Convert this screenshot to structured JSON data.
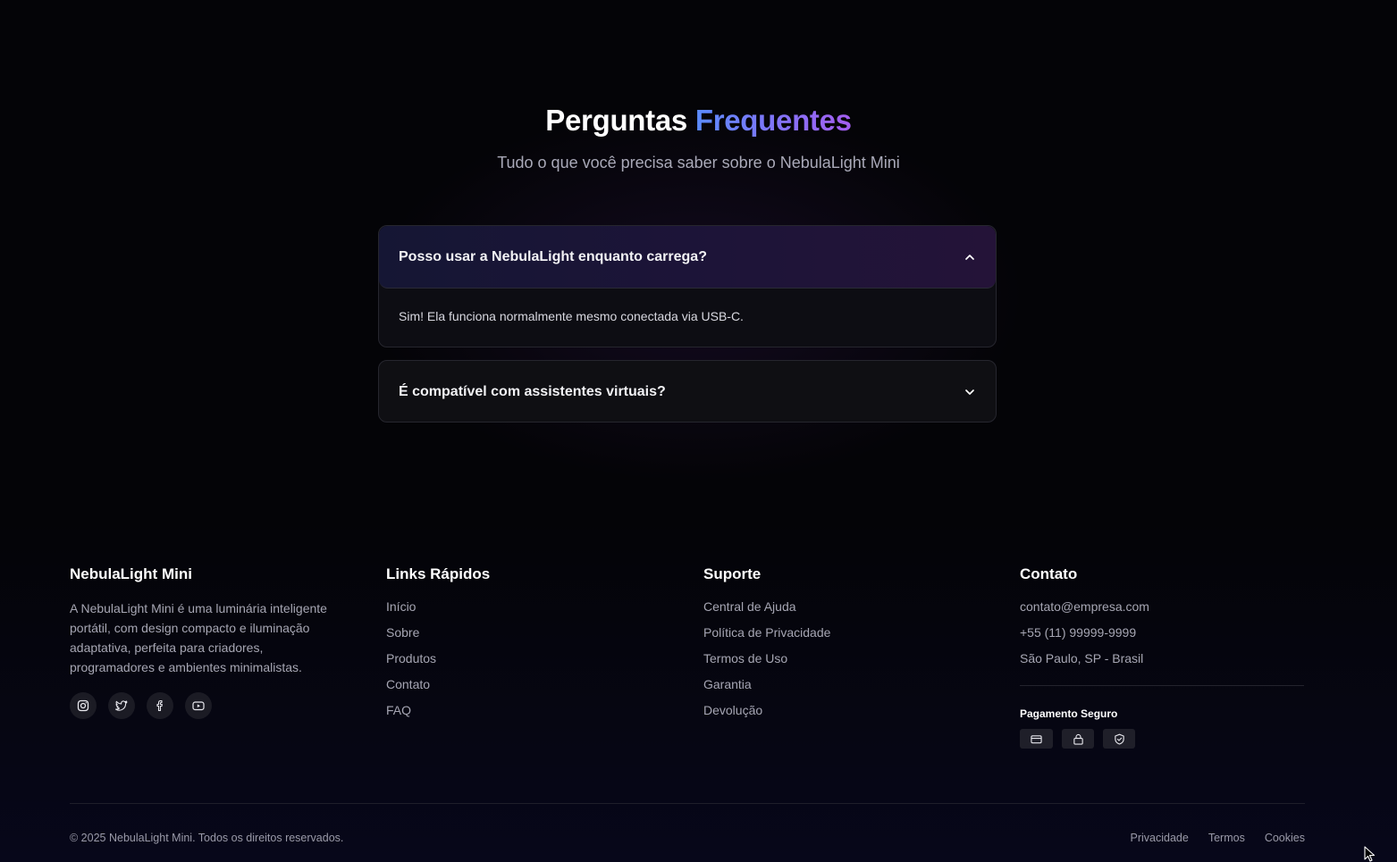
{
  "faq": {
    "title_part1": "Perguntas",
    "title_part2": "Frequentes",
    "subtitle": "Tudo o que você precisa saber sobre o NebulaLight Mini",
    "items": [
      {
        "question": "Posso usar a NebulaLight enquanto carrega?",
        "answer": "Sim! Ela funciona normalmente mesmo conectada via USB-C.",
        "expanded": true
      },
      {
        "question": "É compatível com assistentes virtuais?",
        "answer": "",
        "expanded": false
      }
    ]
  },
  "footer": {
    "brand": {
      "name": "NebulaLight Mini",
      "description": "A NebulaLight Mini é uma luminária inteligente portátil, com design compacto e iluminação adaptativa, perfeita para criadores, programadores e ambientes minimalistas.",
      "socials": [
        "instagram-icon",
        "twitter-icon",
        "facebook-icon",
        "youtube-icon"
      ]
    },
    "quick_links": {
      "title": "Links Rápidos",
      "items": [
        "Início",
        "Sobre",
        "Produtos",
        "Contato",
        "FAQ"
      ]
    },
    "support": {
      "title": "Suporte",
      "items": [
        "Central de Ajuda",
        "Política de Privacidade",
        "Termos de Uso",
        "Garantia",
        "Devolução"
      ]
    },
    "contact": {
      "title": "Contato",
      "email": "contato@empresa.com",
      "phone": "+55 (11) 99999-9999",
      "address": "São Paulo, SP - Brasil",
      "payment_title": "Pagamento Seguro",
      "payment_icons": [
        "credit-card-icon",
        "lock-icon",
        "shield-check-icon"
      ]
    },
    "copyright": "© 2025 NebulaLight Mini. Todos os direitos reservados.",
    "legal": [
      "Privacidade",
      "Termos",
      "Cookies"
    ]
  },
  "colors": {
    "background": "#040407",
    "accent_start": "#5b8cff",
    "accent_end": "#a45df0"
  }
}
